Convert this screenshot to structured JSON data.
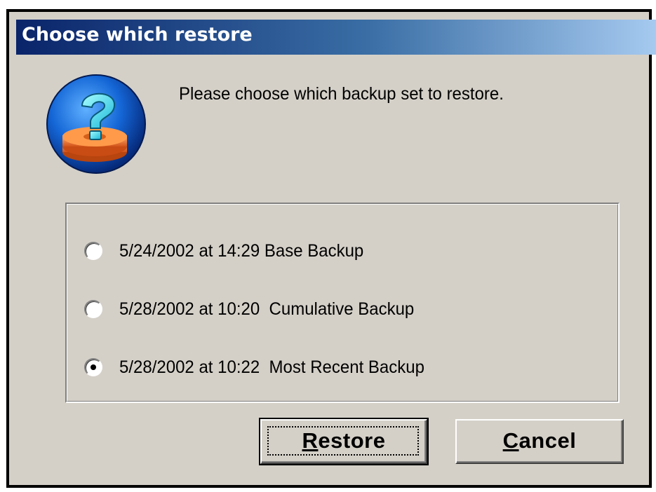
{
  "dialog": {
    "title": "Choose which restore",
    "prompt": "Please choose which backup set to restore.",
    "icon": "question-disk-icon"
  },
  "options": [
    {
      "label": "5/24/2002 at 14:29 Base Backup",
      "selected": false
    },
    {
      "label": "5/28/2002 at 10:20  Cumulative Backup",
      "selected": false
    },
    {
      "label": "5/28/2002 at 10:22  Most Recent Backup",
      "selected": true
    }
  ],
  "buttons": {
    "restore": {
      "mnemonic": "R",
      "rest": "estore"
    },
    "cancel": {
      "mnemonic": "C",
      "rest": "ancel"
    }
  },
  "colors": {
    "titlebar_start": "#0a246a",
    "titlebar_end": "#a6caf0",
    "dialog_face": "#d4d0c8"
  }
}
